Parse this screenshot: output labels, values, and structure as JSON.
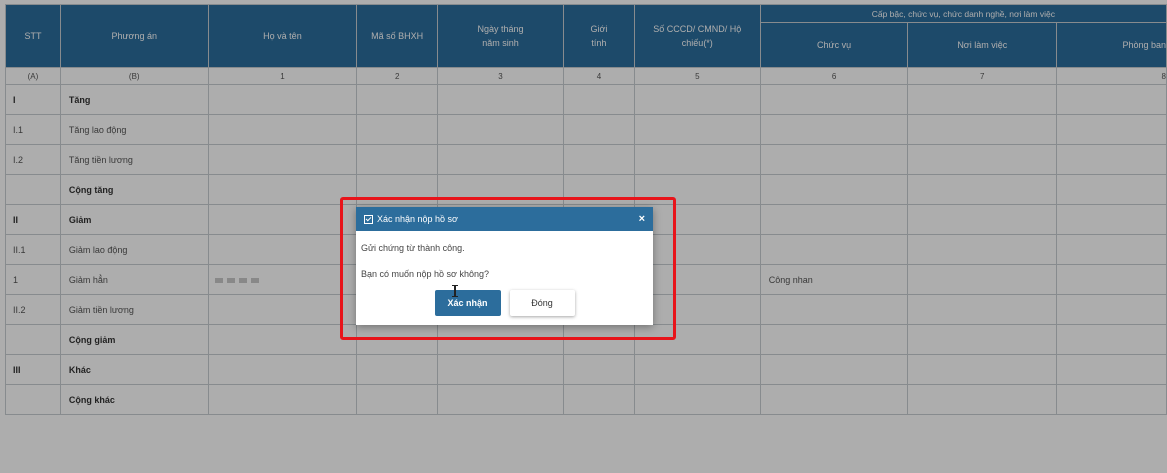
{
  "table": {
    "headers": {
      "stt": "STT",
      "phuong_an": "Phương án",
      "ho_ten": "Họ và tên",
      "ma_bhxh": "Mã số BHXH",
      "ngay_sinh": "Ngày tháng năm sinh",
      "gioi_tinh": "Giới tính",
      "cccd": "Số CCCD/ CMND/ Hộ chiếu(*)",
      "group_cap_bac": "Cấp bậc, chức vụ, chức danh nghề, nơi làm việc",
      "chuc_vu": "Chức vụ",
      "noi_lam_viec": "Nơi làm việc",
      "phong_ban": "Phòng ban"
    },
    "index_row": [
      "(A)",
      "(B)",
      "1",
      "2",
      "3",
      "4",
      "5",
      "6",
      "7",
      "8"
    ],
    "rows": [
      {
        "stt": "I",
        "label": "Tăng",
        "bold": true,
        "name": "",
        "position": ""
      },
      {
        "stt": "I.1",
        "label": "Tăng lao động",
        "bold": false,
        "name": "",
        "position": ""
      },
      {
        "stt": "I.2",
        "label": "Tăng tiền lương",
        "bold": false,
        "name": "",
        "position": ""
      },
      {
        "stt": "",
        "label": "Cộng tăng",
        "bold": true,
        "name": "",
        "position": ""
      },
      {
        "stt": "II",
        "label": "Giảm",
        "bold": true,
        "name": "",
        "position": ""
      },
      {
        "stt": "II.1",
        "label": "Giảm lao động",
        "bold": false,
        "name": "",
        "position": ""
      },
      {
        "stt": "1",
        "label": "Giảm hẳn",
        "bold": false,
        "name": "redacted",
        "position": "Công nhan"
      },
      {
        "stt": "II.2",
        "label": "Giảm tiền lương",
        "bold": false,
        "name": "",
        "position": ""
      },
      {
        "stt": "",
        "label": "Cộng giảm",
        "bold": true,
        "name": "",
        "position": ""
      },
      {
        "stt": "III",
        "label": "Khác",
        "bold": true,
        "name": "",
        "position": ""
      },
      {
        "stt": "",
        "label": "Cộng khác",
        "bold": true,
        "name": "",
        "position": ""
      }
    ]
  },
  "dialog": {
    "title": "Xác nhận nộp hồ sơ",
    "close_glyph": "×",
    "message_1": "Gửi chứng từ thành công.",
    "message_2": "Bạn có muốn nộp hồ sơ không?",
    "confirm_label": "Xác nhận",
    "close_label": "Đóng"
  },
  "colors": {
    "header_blue": "#2c6d9c",
    "highlight_red": "#e8141a"
  },
  "icons": {
    "title_icon": "check-square-icon",
    "close_icon": "close-icon",
    "cursor": "text-cursor-icon"
  }
}
